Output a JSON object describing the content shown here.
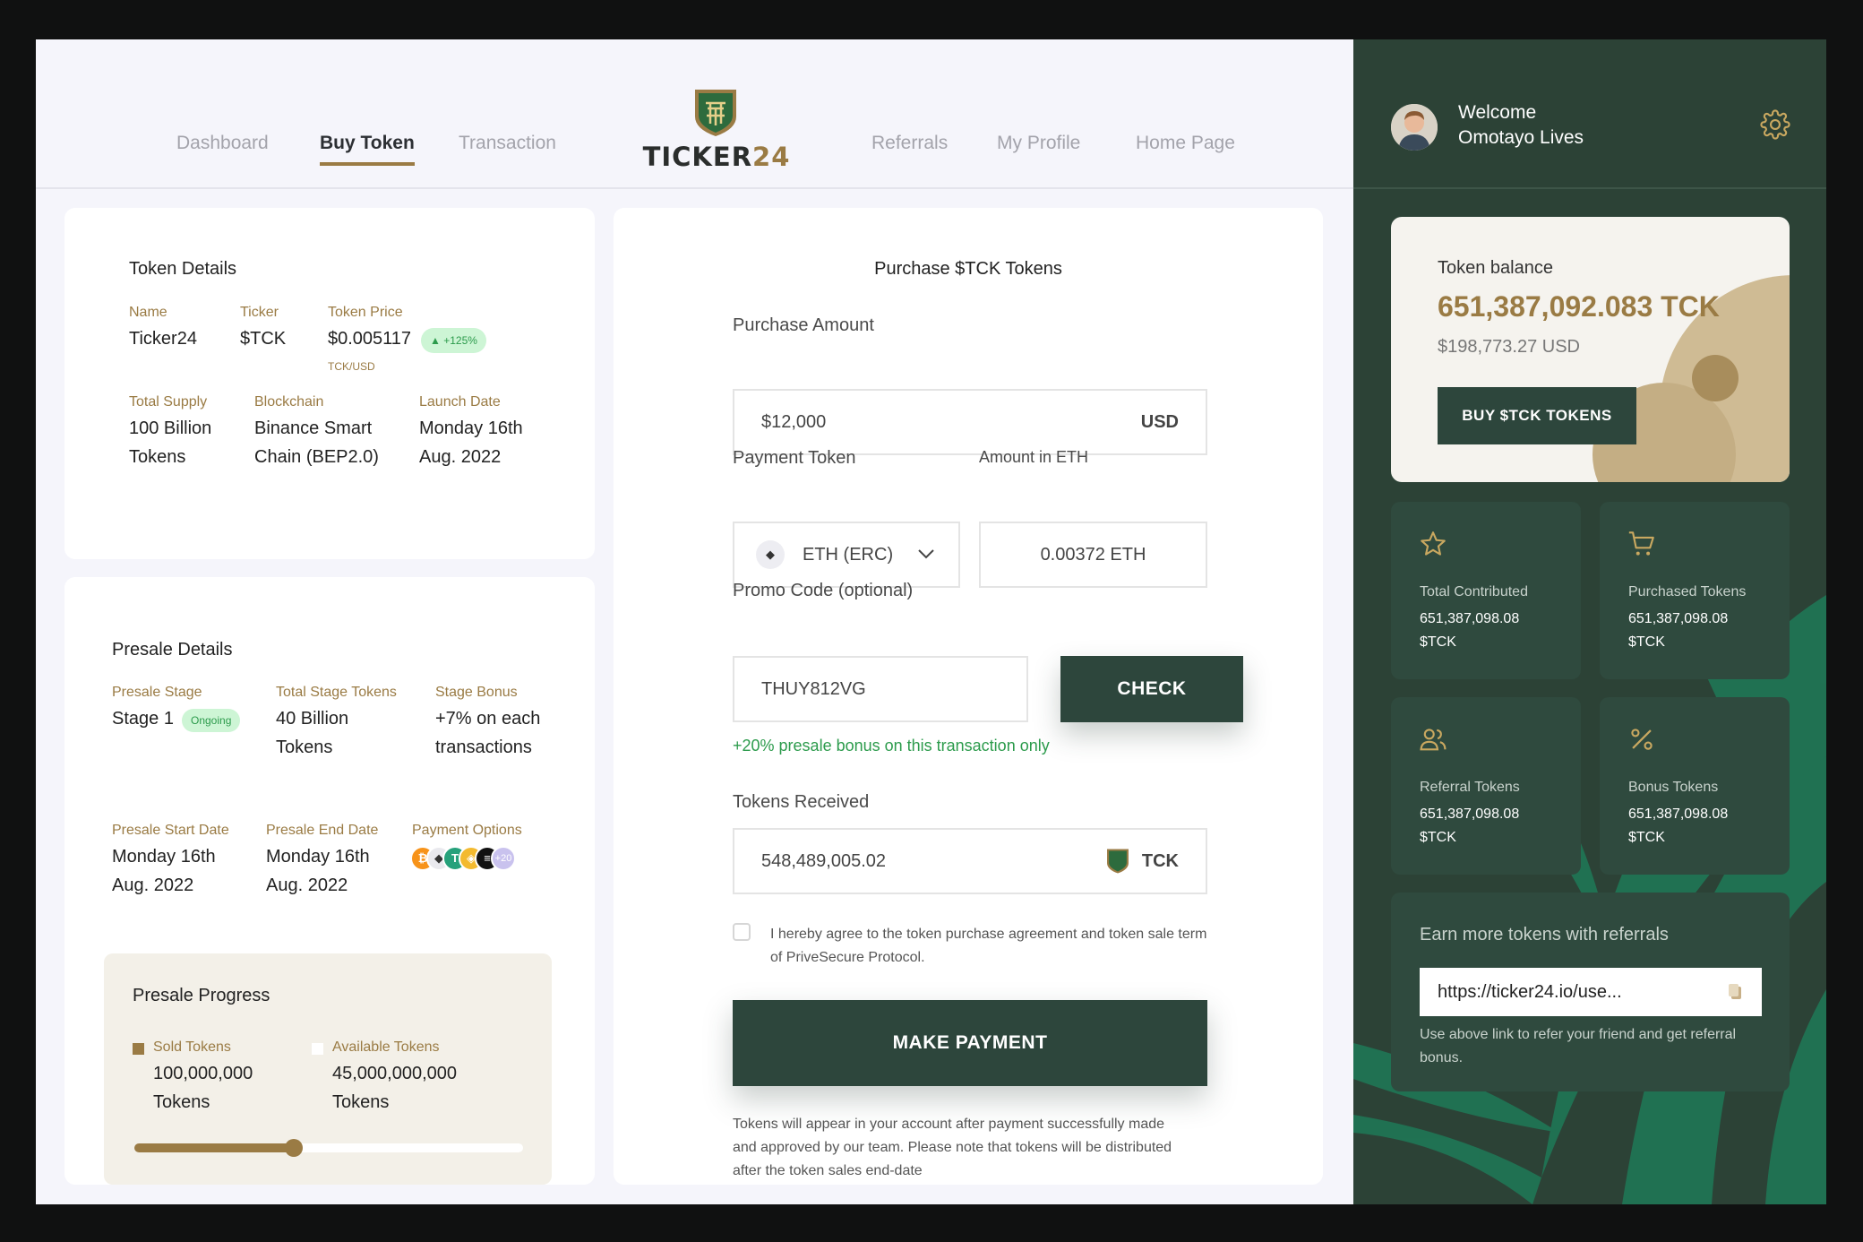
{
  "nav": {
    "items": [
      "Dashboard",
      "Buy Token",
      "Transaction",
      "Referrals",
      "My Profile",
      "Home Page"
    ],
    "logo_main": "TICKER",
    "logo_num": "24"
  },
  "token_details": {
    "title": "Token Details",
    "name_label": "Name",
    "name": "Ticker24",
    "ticker_label": "Ticker",
    "ticker": "$TCK",
    "price_label": "Token Price",
    "price": "$0.005117",
    "price_unit": "TCK/USD",
    "price_change": "+125%",
    "supply_label": "Total Supply",
    "supply_l1": "100 Billion",
    "supply_l2": "Tokens",
    "chain_label": "Blockchain",
    "chain_l1": "Binance Smart",
    "chain_l2": "Chain (BEP2.0)",
    "launch_label": "Launch Date",
    "launch_l1": "Monday 16th",
    "launch_l2": "Aug. 2022"
  },
  "presale": {
    "title": "Presale Details",
    "stage_label": "Presale Stage",
    "stage": "Stage 1",
    "stage_status": "Ongoing",
    "stage_tokens_label": "Total Stage Tokens",
    "stage_tokens_l1": "40 Billion",
    "stage_tokens_l2": "Tokens",
    "bonus_label": "Stage Bonus",
    "bonus_l1": "+7% on each",
    "bonus_l2": "transactions",
    "start_label": "Presale Start Date",
    "start_l1": "Monday 16th",
    "start_l2": "Aug. 2022",
    "end_label": "Presale End Date",
    "end_l1": "Monday 16th",
    "end_l2": "Aug. 2022",
    "payment_label": "Payment Options",
    "payment_more": "+20",
    "coins": [
      {
        "icon": "bitcoin-icon",
        "glyph": "₿",
        "color": "#f7931a"
      },
      {
        "icon": "ethereum-icon",
        "glyph": "◆",
        "color": "#e9e9ee"
      },
      {
        "icon": "tether-icon",
        "glyph": "T",
        "color": "#26a17b"
      },
      {
        "icon": "bnb-icon",
        "glyph": "◈",
        "color": "#f3ba2f"
      },
      {
        "icon": "solana-icon",
        "glyph": "≡",
        "color": "#111111"
      }
    ],
    "progress": {
      "title": "Presale Progress",
      "sold_label": "Sold Tokens",
      "sold_l1": "100,000,000",
      "sold_l2": "Tokens",
      "available_label": "Available Tokens",
      "available_l1": "45,000,000,000",
      "available_l2": "Tokens",
      "progress_fraction": 0.41
    }
  },
  "purchase": {
    "title": "Purchase $TCK Tokens",
    "amount_label": "Purchase Amount",
    "amount_value": "$12,000",
    "amount_currency": "USD",
    "payment_token_label": "Payment Token",
    "payment_token_value": "ETH (ERC)",
    "amount_eth_label": "Amount in ETH",
    "amount_eth_value": "0.00372 ETH",
    "promo_label": "Promo Code (optional)",
    "promo_value": "THUY812VG",
    "check_label": "CHECK",
    "promo_message": "+20% presale bonus on this transaction only",
    "received_label": "Tokens Received",
    "received_value": "548,489,005.02",
    "received_unit": "TCK",
    "agree_text": "I hereby agree to the token purchase agreement and token sale term of PriveSecure Protocol.",
    "pay_label": "MAKE PAYMENT",
    "footnote": "Tokens will appear in your account after payment successfully made and approved by our team. Please note that tokens will be distributed after the token sales end-date"
  },
  "sidebar": {
    "welcome": "Welcome",
    "user_name": "Omotayo Lives",
    "balance": {
      "label": "Token balance",
      "tck": "651,387,092.083 TCK",
      "usd": "$198,773.27 USD",
      "buy_label": "BUY $TCK TOKENS"
    },
    "stats": [
      {
        "icon": "star-icon",
        "label": "Total Contributed",
        "value_l1": "651,387,098.08",
        "value_l2": "$TCK"
      },
      {
        "icon": "cart-icon",
        "label": "Purchased Tokens",
        "value_l1": "651,387,098.08",
        "value_l2": "$TCK"
      },
      {
        "icon": "users-icon",
        "label": "Referral Tokens",
        "value_l1": "651,387,098.08",
        "value_l2": "$TCK"
      },
      {
        "icon": "percent-icon",
        "label": "Bonus Tokens",
        "value_l1": "651,387,098.08",
        "value_l2": "$TCK"
      }
    ],
    "referral": {
      "title": "Earn more tokens with referrals",
      "link": "https://ticker24.io/use...",
      "note": "Use above link to refer your friend and get referral bonus."
    }
  },
  "colors": {
    "accent_gold": "#9a7b44",
    "dark_green": "#2d463c",
    "promo_green": "#2c9b4c"
  }
}
